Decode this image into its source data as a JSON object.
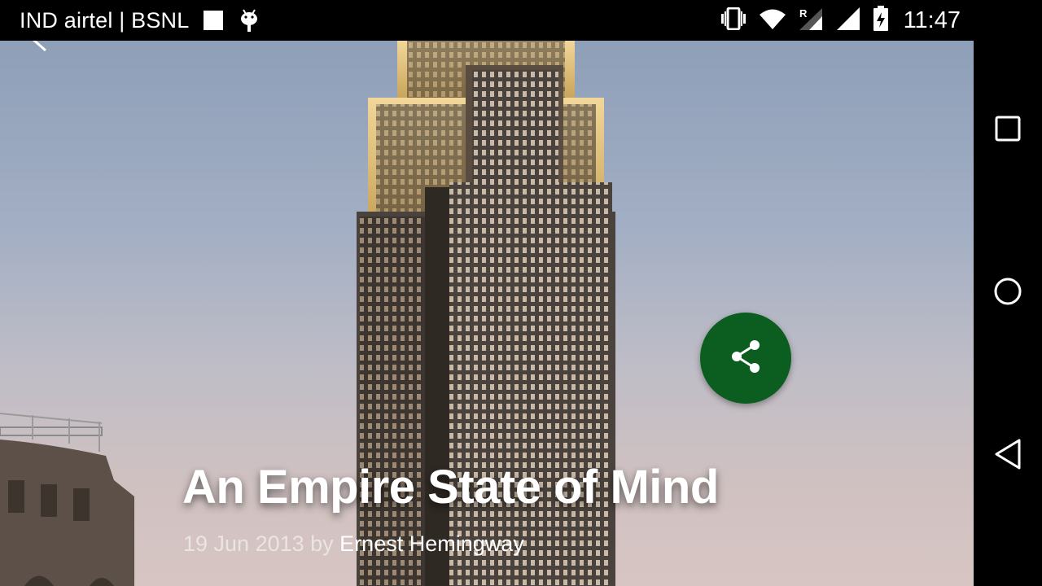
{
  "status_bar": {
    "carrier": "IND airtel | BSNL",
    "time": "11:47",
    "icons": [
      "notification-square-icon",
      "android-debug-icon",
      "vibrate-icon",
      "wifi-icon",
      "roaming-signal-icon",
      "cell-signal-icon",
      "battery-charging-icon"
    ]
  },
  "article": {
    "title": "An Empire State of Mind",
    "date_prefix": "19 Jun 2013 by",
    "author": "Ernest Hemingway"
  },
  "actions": {
    "share_icon": "share-icon",
    "back_icon": "back-chevron-icon"
  },
  "nav_bar": {
    "icons": [
      "recents-square-icon",
      "home-circle-icon",
      "back-triangle-icon"
    ]
  },
  "colors": {
    "fab": "#0b5e1f",
    "status_bar": "#000000",
    "title_text": "#ffffff"
  }
}
